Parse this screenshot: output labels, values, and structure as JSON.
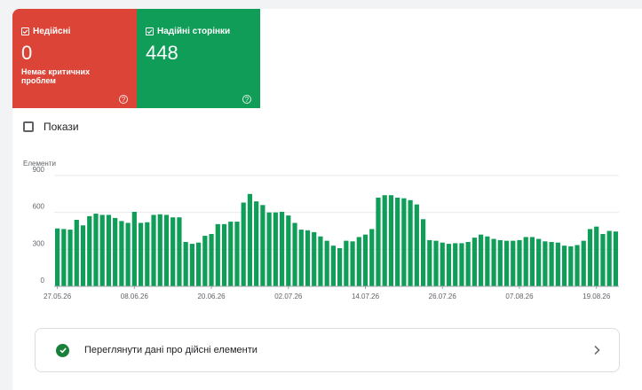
{
  "tiles": {
    "invalid": {
      "label": "Недійсні",
      "count": "0",
      "subtitle": "Немає критичних проблем",
      "color": "#db4437"
    },
    "valid": {
      "label": "Надійні сторінки",
      "count": "448",
      "color": "#0f9d58"
    }
  },
  "impressions_toggle": {
    "label": "Покази",
    "checked": false
  },
  "chart_data": {
    "type": "bar",
    "ylabel": "Елементи",
    "ylim": [
      0,
      900
    ],
    "yticks": [
      0,
      300,
      600,
      900
    ],
    "x_tick_labels": [
      "27.05.26",
      "08.06.26",
      "20.06.26",
      "02.07.26",
      "14.07.26",
      "26.07.26",
      "07.08.26",
      "19.08.26"
    ],
    "x_tick_indices": [
      0,
      12,
      24,
      36,
      48,
      60,
      72,
      84
    ],
    "color": "#0f9d58",
    "values": [
      470,
      465,
      460,
      540,
      495,
      570,
      590,
      580,
      580,
      555,
      530,
      515,
      605,
      515,
      520,
      580,
      585,
      580,
      560,
      560,
      360,
      345,
      355,
      410,
      425,
      505,
      505,
      525,
      525,
      680,
      750,
      690,
      660,
      600,
      600,
      605,
      575,
      515,
      460,
      455,
      440,
      405,
      370,
      330,
      310,
      370,
      365,
      400,
      420,
      465,
      720,
      740,
      740,
      720,
      715,
      700,
      665,
      545,
      375,
      370,
      355,
      345,
      350,
      350,
      360,
      395,
      420,
      405,
      385,
      375,
      370,
      370,
      375,
      400,
      400,
      385,
      365,
      360,
      355,
      330,
      325,
      335,
      370,
      465,
      485,
      425,
      450,
      445
    ]
  },
  "view_details": {
    "label": "Переглянути дані про дійсні елементи"
  }
}
